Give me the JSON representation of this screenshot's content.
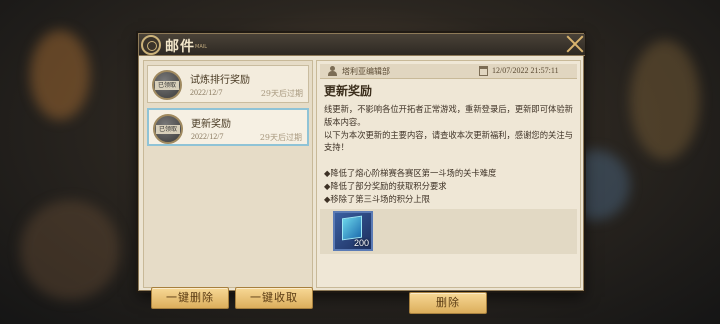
{
  "window": {
    "title": "邮件",
    "title_sub": "MAIL"
  },
  "mail_list": [
    {
      "badge": "已领取",
      "title": "试炼排行奖励",
      "date": "2022/12/7",
      "expire": "29天后过期",
      "selected": false
    },
    {
      "badge": "已领取",
      "title": "更新奖励",
      "date": "2022/12/7",
      "expire": "29天后过期",
      "selected": true
    }
  ],
  "buttons": {
    "delete_all": "一键删除",
    "collect_all": "一键收取",
    "delete": "删除"
  },
  "detail": {
    "sender": "塔利亚编辑部",
    "sent_time": "12/07/2022 21:57:11",
    "subject": "更新奖励",
    "body": "线更新，不影响各位开拓者正常游戏，重新登录后，更新即可体验新版本内容。\n以下为本次更新的主要内容，请查收本次更新福利，感谢您的关注与支持！\n\n◆降低了熔心阶梯赛各赛区第一斗场的关卡难度\n◆降低了部分奖励的获取积分要求\n◆移除了第三斗场的积分上限",
    "attachments": [
      {
        "icon": "crystal-cube-icon",
        "count": "200"
      }
    ]
  },
  "colors": {
    "panel": "#ece4d2",
    "title_bar": "#2e2923",
    "selected_border": "#8fc3d6",
    "button_gold": "#dcae5c"
  }
}
